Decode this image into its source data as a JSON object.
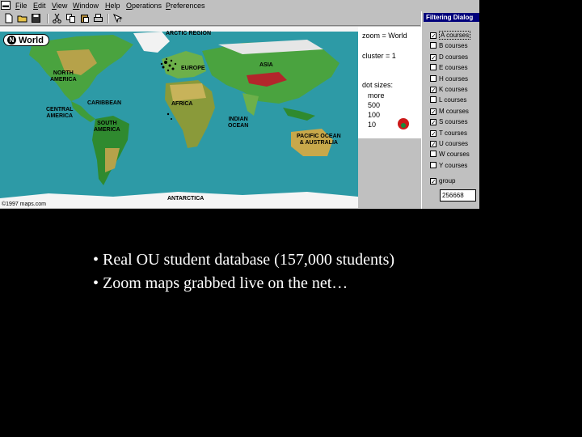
{
  "menu": {
    "items": [
      {
        "key": "F",
        "rest": "ile"
      },
      {
        "key": "E",
        "rest": "dit"
      },
      {
        "key": "V",
        "rest": "iew"
      },
      {
        "key": "W",
        "rest": "indow"
      },
      {
        "key": "H",
        "rest": "elp"
      },
      {
        "key": "O",
        "rest": "perations"
      },
      {
        "key": "P",
        "rest": "references"
      }
    ]
  },
  "toolbar": {
    "icons": [
      "new-file-icon",
      "open-folder-icon",
      "save-icon",
      "cut-icon",
      "copy-icon",
      "paste-icon",
      "print-icon",
      "help-icon"
    ]
  },
  "map": {
    "world_label": "World",
    "world_badge": "N",
    "regions": {
      "arctic": "ARCTIC REGION",
      "north_america": "NORTH\nAMERICA",
      "europe": "EUROPE",
      "asia": "ASIA",
      "caribbean": "CARIBBEAN",
      "central_america": "CENTRAL\nAMERICA",
      "africa": "AFRICA",
      "south_america": "SOUTH\nAMERICA",
      "indian_ocean": "INDIAN\nOCEAN",
      "pacific": "PACIFIC OCEAN\n& AUSTRALIA",
      "antarctica": "ANTARCTICA"
    },
    "copyright": "©1997 maps.com"
  },
  "info_panel": {
    "zoom": "zoom = World",
    "cluster": "cluster = 1",
    "dot_sizes": "dot sizes:",
    "more": "more",
    "v500": "500",
    "v100": "100",
    "v10": "10"
  },
  "filter": {
    "title": "Filtering Dialog",
    "items": [
      {
        "label": "A courses",
        "checked": true
      },
      {
        "label": "B courses",
        "checked": false
      },
      {
        "label": "D courses",
        "checked": true
      },
      {
        "label": "E courses",
        "checked": false
      },
      {
        "label": "H courses",
        "checked": false
      },
      {
        "label": "K courses",
        "checked": true
      },
      {
        "label": "L courses",
        "checked": false
      },
      {
        "label": "M courses",
        "checked": true
      },
      {
        "label": "S courses",
        "checked": true
      },
      {
        "label": "T courses",
        "checked": true
      },
      {
        "label": "U courses",
        "checked": true
      },
      {
        "label": "W courses",
        "checked": false
      },
      {
        "label": "Y courses",
        "checked": false
      }
    ],
    "group_label": "group",
    "group_checked": true,
    "group_value": "256668"
  },
  "bullets": [
    "• Real OU student database (157,000 students)",
    "• Zoom maps grabbed live on the net…"
  ],
  "colors": {
    "ocean": "#2d9aa6",
    "land": "#3f9c3a",
    "title_bar": "#00007b"
  }
}
